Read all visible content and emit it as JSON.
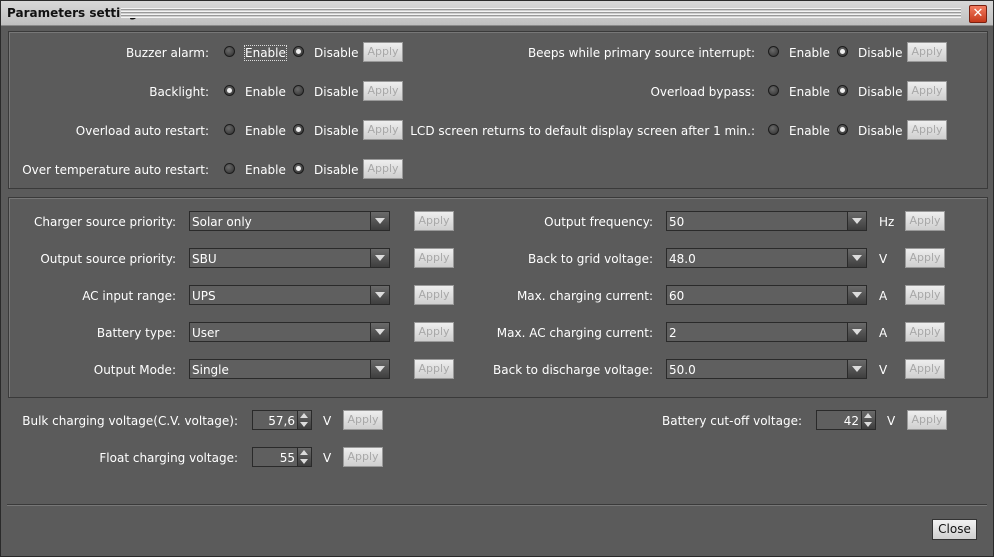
{
  "window": {
    "title": "Parameters setting"
  },
  "radios": {
    "enable": "Enable",
    "disable": "Disable",
    "apply": "Apply",
    "items": [
      {
        "label": "Buzzer alarm:",
        "selected": "disable"
      },
      {
        "label": "Backlight:",
        "selected": "enable"
      },
      {
        "label": "Overload auto restart:",
        "selected": "disable"
      },
      {
        "label": "Over temperature auto restart:",
        "selected": "disable"
      },
      {
        "label": "Beeps while primary source interrupt:",
        "selected": "disable"
      },
      {
        "label": "Overload bypass:",
        "selected": "disable"
      },
      {
        "label": "LCD screen returns to default display screen after 1 min.:",
        "selected": "disable"
      }
    ]
  },
  "combos": {
    "apply": "Apply",
    "left": [
      {
        "label": "Charger source priority:",
        "value": "Solar only"
      },
      {
        "label": "Output source priority:",
        "value": "SBU"
      },
      {
        "label": "AC input range:",
        "value": "UPS"
      },
      {
        "label": "Battery type:",
        "value": "User"
      },
      {
        "label": "Output Mode:",
        "value": "Single"
      }
    ],
    "right": [
      {
        "label": "Output frequency:",
        "value": "50",
        "unit": "Hz"
      },
      {
        "label": "Back to grid voltage:",
        "value": "48.0",
        "unit": "V"
      },
      {
        "label": "Max. charging current:",
        "value": "60",
        "unit": "A"
      },
      {
        "label": "Max. AC charging current:",
        "value": "2",
        "unit": "A"
      },
      {
        "label": "Back to discharge voltage:",
        "value": "50.0",
        "unit": "V"
      }
    ]
  },
  "spinners": {
    "apply": "Apply",
    "bulk": {
      "label": "Bulk charging voltage(C.V. voltage):",
      "value": "57,6",
      "unit": "V"
    },
    "float": {
      "label": "Float charging voltage:",
      "value": "55",
      "unit": "V"
    },
    "cutoff": {
      "label": "Battery cut-off voltage:",
      "value": "42",
      "unit": "V"
    }
  },
  "footer": {
    "close_label": "Close"
  }
}
